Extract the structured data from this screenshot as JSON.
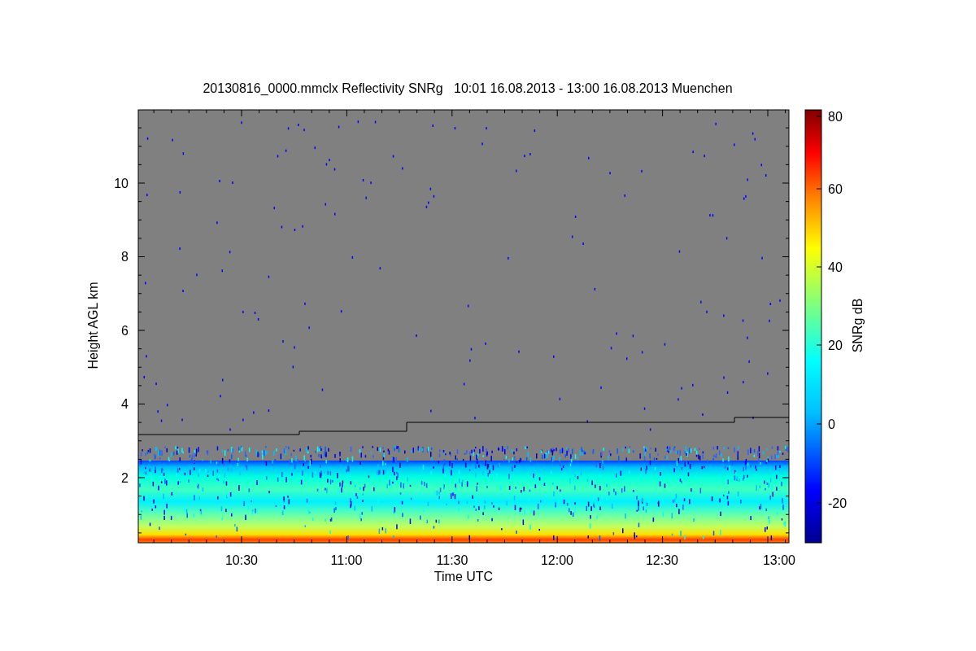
{
  "title": "20130816_0000.mmclx Reflectivity SNRg   10:01 16.08.2013 - 13:00 16.08.2013 Muenchen",
  "xlabel": "Time UTC",
  "ylabel": "Height AGL km",
  "xtick_labels": [
    "10:30",
    "11:00",
    "11:30",
    "12:00",
    "12:30",
    "13:00"
  ],
  "ytick_labels": [
    "10",
    "8",
    "6",
    "4",
    "2"
  ],
  "colorbar": {
    "label": "SNRg dB",
    "tick_labels": [
      "80",
      "60",
      "40",
      "20",
      "0",
      "-20"
    ]
  }
}
